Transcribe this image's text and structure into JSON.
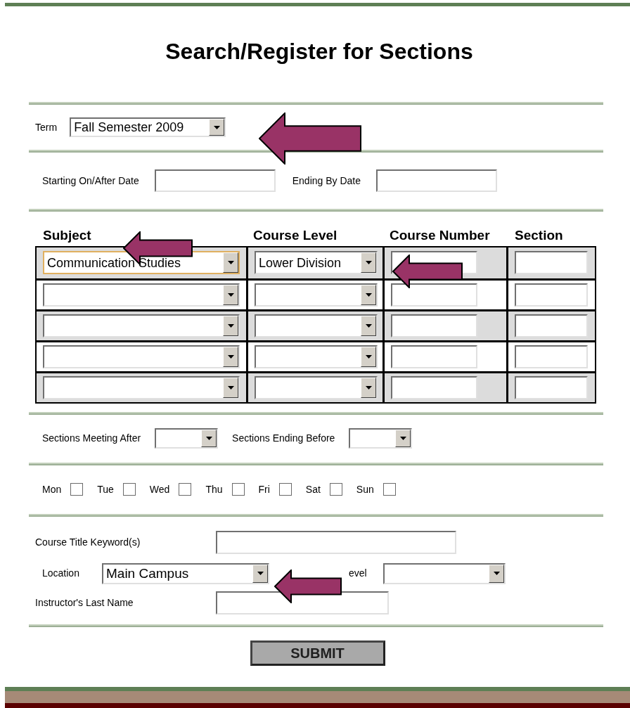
{
  "title": "Search/Register for Sections",
  "term": {
    "label": "Term",
    "value": "Fall Semester 2009"
  },
  "dates": [
    {
      "label": "Starting On/After Date"
    },
    {
      "label": "Ending By Date"
    }
  ],
  "table": {
    "columns": [
      "Subject",
      "Course Level",
      "Course Number",
      "Section"
    ],
    "rows": [
      {
        "subject": "Communication Studies",
        "course_level": "Lower Division",
        "focused": true
      },
      {
        "focused": false
      },
      {
        "focused": false
      },
      {
        "focused": false
      },
      {
        "focused": false
      }
    ]
  },
  "times": [
    {
      "label": "Sections Meeting After"
    },
    {
      "label": "Sections Ending Before"
    }
  ],
  "days": [
    {
      "label": "Mon",
      "checked": false
    },
    {
      "label": "Tue",
      "checked": false
    },
    {
      "label": "Wed",
      "checked": false
    },
    {
      "label": "Thu",
      "checked": false
    },
    {
      "label": "Fri",
      "checked": false
    },
    {
      "label": "Sat",
      "checked": false
    },
    {
      "label": "Sun",
      "checked": false
    }
  ],
  "keyword": {
    "label": "Course Title Keyword(s)"
  },
  "location": {
    "label": "Location",
    "value": "Main Campus"
  },
  "level": {
    "label": "evel"
  },
  "instructor": {
    "label": "Instructor's Last Name"
  },
  "submit": "SUBMIT"
}
